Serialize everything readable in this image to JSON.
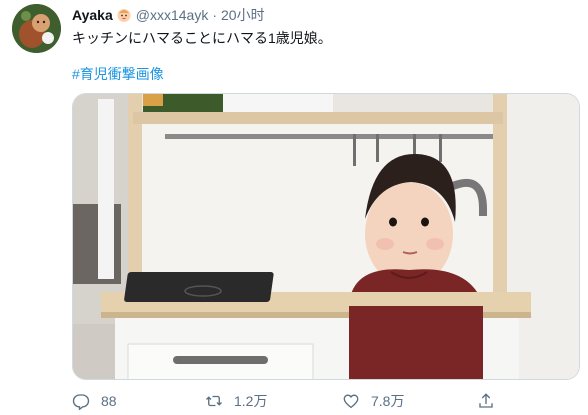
{
  "tweet": {
    "display_name": "Ayaka",
    "handle": "@xxx14ayk",
    "separator": "·",
    "time": "20小时",
    "text": "キッチンにハマることにハマる1歳児娘。",
    "hashtag": "#育児衝撃画像"
  },
  "actions": {
    "reply_count": "88",
    "retweet_count": "1.2万",
    "like_count": "7.8万"
  },
  "icons": {
    "reply": "reply-icon",
    "retweet": "retweet-icon",
    "like": "heart-icon",
    "share": "share-icon",
    "name_emoji": "baby-face-icon"
  },
  "colors": {
    "link": "#1b95e0",
    "muted": "#5b7083",
    "text": "#0f1419"
  }
}
